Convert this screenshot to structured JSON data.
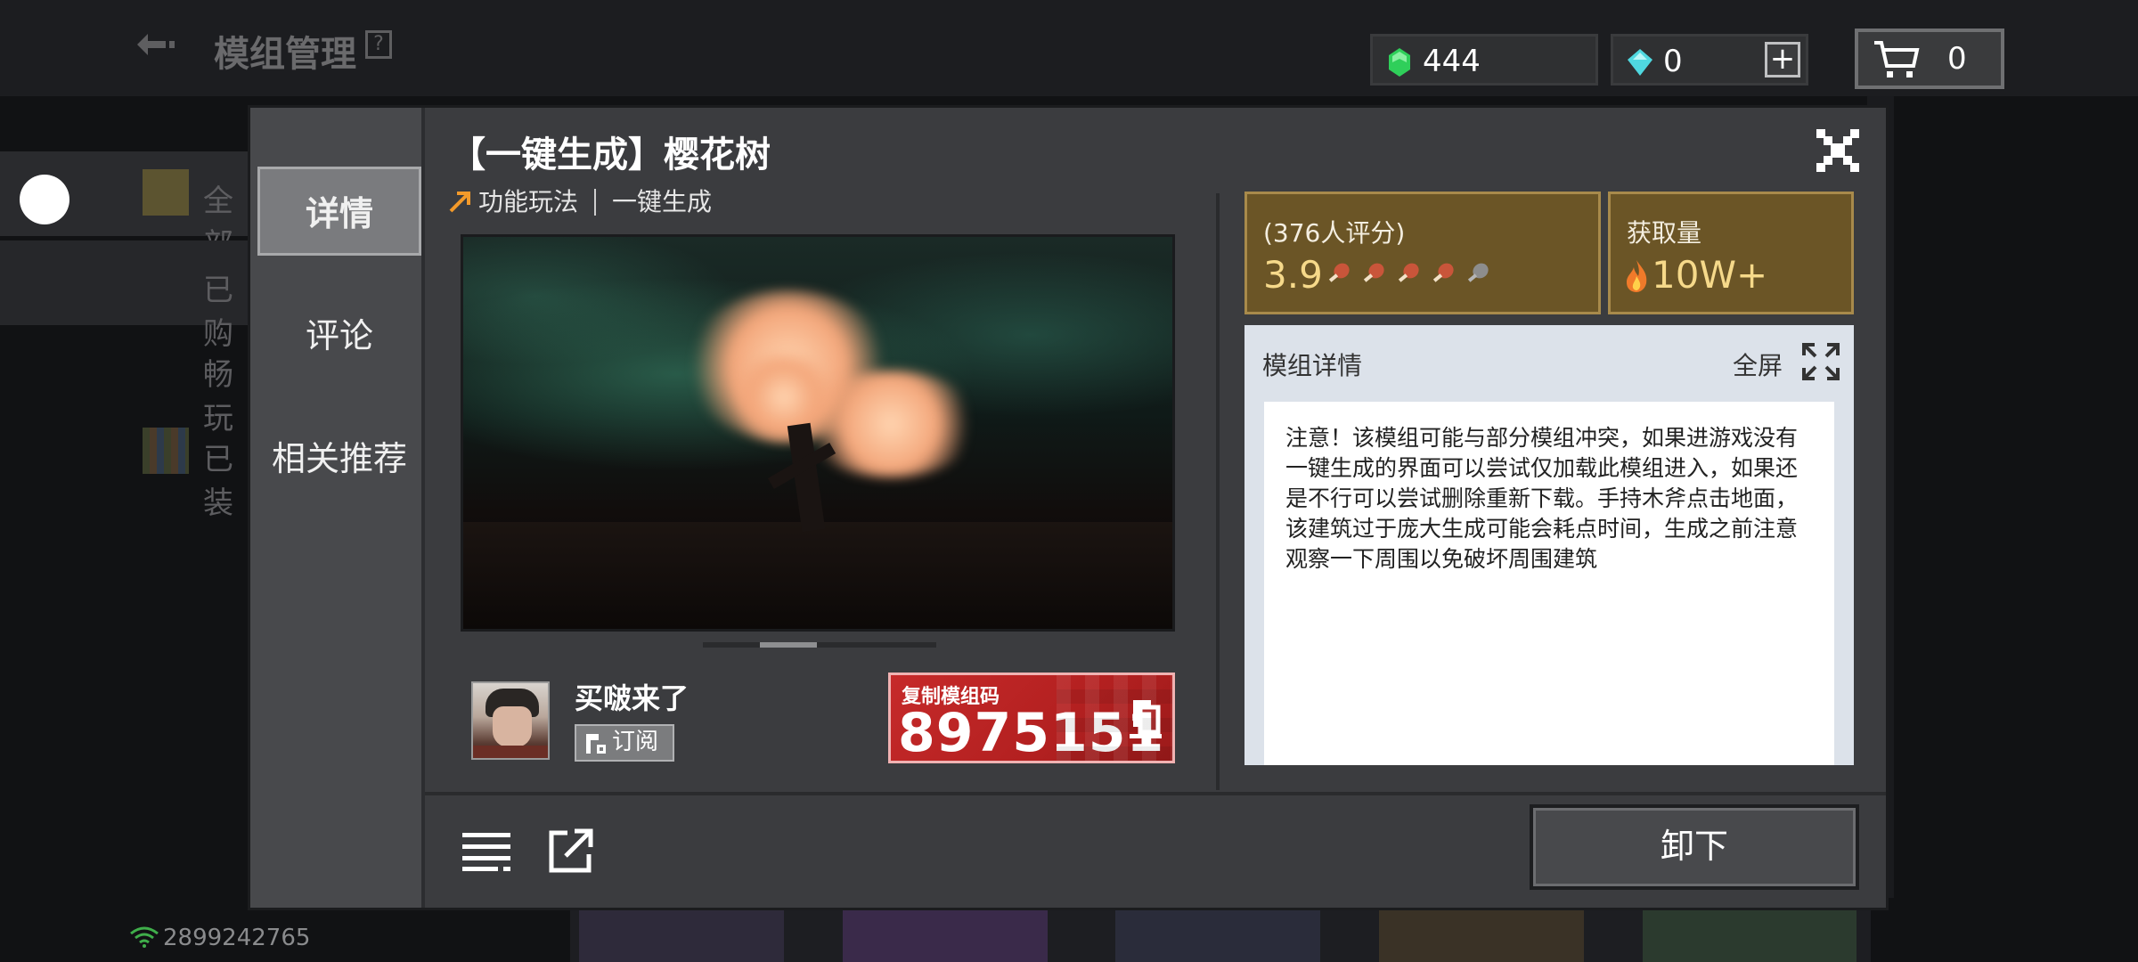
{
  "background": {
    "header_title": "模组管理",
    "help_mark": "?",
    "side_items": [
      "全部",
      "已购",
      "畅玩",
      "已装"
    ],
    "footer_id": "2899242765"
  },
  "currency": {
    "emeralds": "444",
    "diamonds": "0",
    "add_label": "+",
    "cart_count": "0",
    "emerald_color": "#2fcf5a",
    "diamond_color": "#4fd8e0"
  },
  "tabs": [
    {
      "label": "详情",
      "active": true
    },
    {
      "label": "评论",
      "active": false
    },
    {
      "label": "相关推荐",
      "active": false
    }
  ],
  "mod": {
    "title": "【一键生成】樱花树",
    "category": "功能玩法",
    "tag": "一键生成",
    "author": "买啵来了",
    "subscribe_label": "订阅",
    "code_label": "复制模组码",
    "code": "8975151",
    "rating_count_label": "(376人评分)",
    "rating": "3.9",
    "rating_icons": 5,
    "downloads_label": "获取量",
    "downloads": "10W+",
    "detail_title": "模组详情",
    "fullscreen_label": "全屏",
    "description": "注意！该模组可能与部分模组冲突，如果进游戏没有一键生成的界面可以尝试仅加载此模组进入，如果还是不行可以尝试删除重新下载。手持木斧点击地面，该建筑过于庞大生成可能会耗点时间，生成之前注意观察一下周围以免破坏周围建筑"
  },
  "actions": {
    "uninstall_label": "卸下"
  },
  "colors": {
    "accent_gold": "#f6d98a",
    "stat_bg": "#6b5526",
    "code_red": "#c62a2a"
  }
}
